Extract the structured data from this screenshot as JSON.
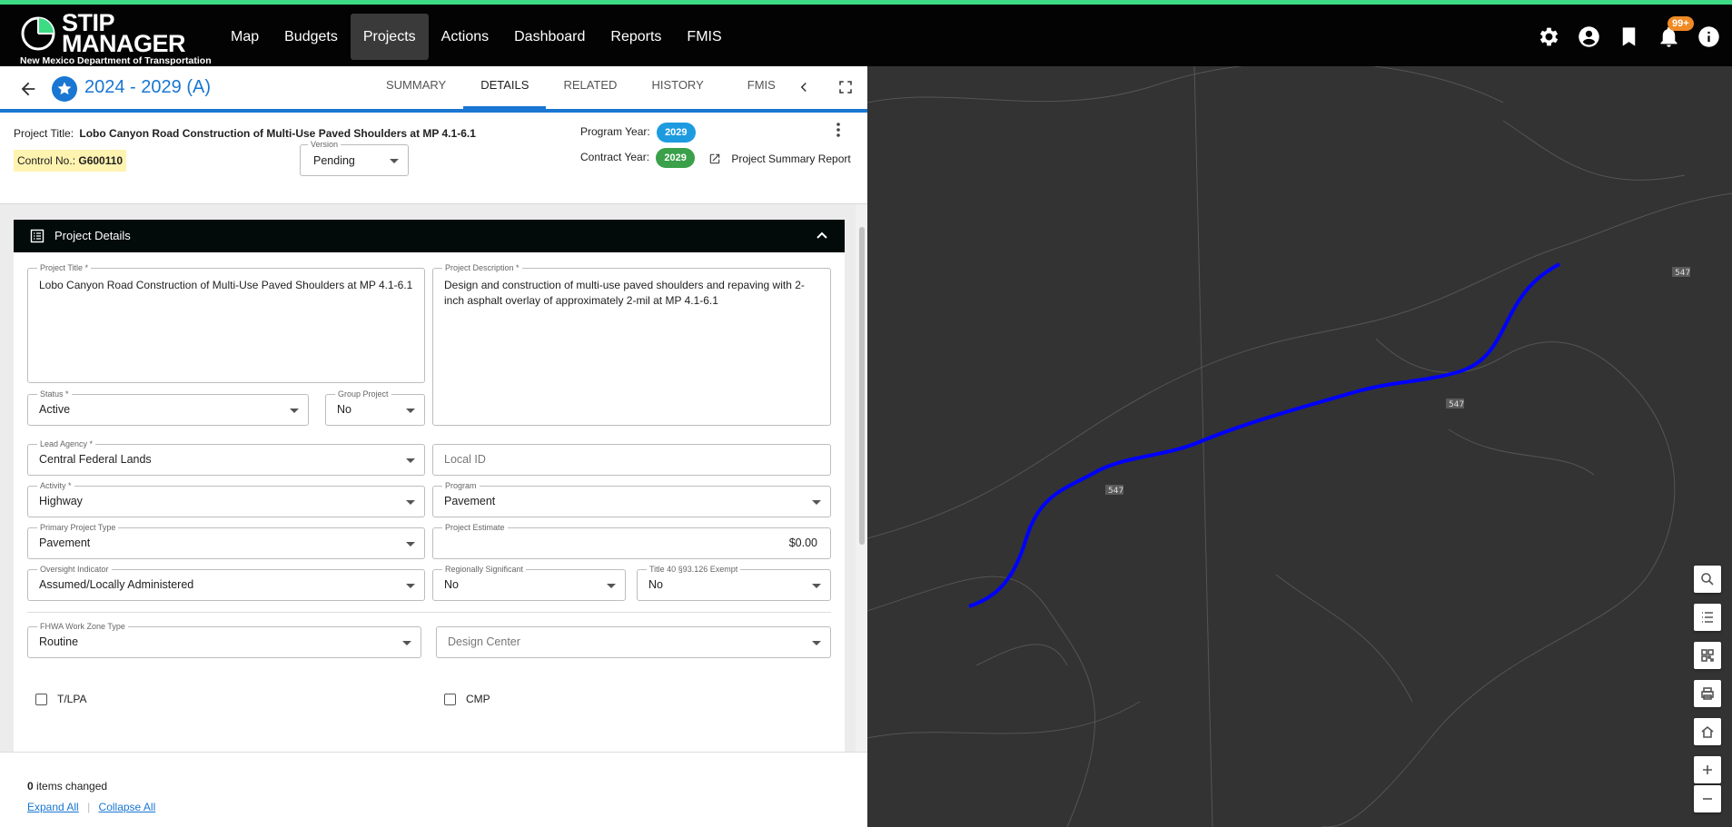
{
  "app": {
    "logo_title_1": "STIP",
    "logo_title_2": "MANAGER",
    "logo_subtitle": "New Mexico Department of Transportation",
    "nav": [
      "Map",
      "Budgets",
      "Projects",
      "Actions",
      "Dashboard",
      "Reports",
      "FMIS"
    ],
    "active_nav": "Projects",
    "notification_count": "99+",
    "accent_color": "#1976d2",
    "top_border_color": "#3ddc84"
  },
  "project_header": {
    "title": "2024 - 2029 (A)",
    "tabs": [
      "SUMMARY",
      "DETAILS",
      "RELATED",
      "HISTORY",
      "FMIS"
    ],
    "active_tab": "DETAILS"
  },
  "summary": {
    "project_title_label": "Project Title:",
    "project_title_value": "Lobo Canyon Road Construction of Multi-Use Paved Shoulders at MP 4.1-6.1",
    "program_year_label": "Program Year:",
    "program_year": "2029",
    "control_no_label": "Control No.:",
    "control_no": "G600110",
    "version_label": "Version",
    "version_value": "Pending",
    "contract_year_label": "Contract Year:",
    "contract_year": "2029",
    "report_link": "Project Summary Report"
  },
  "details": {
    "section_title": "Project Details",
    "project_title_label": "Project Title *",
    "project_title": "Lobo Canyon Road Construction of Multi-Use Paved Shoulders at MP 4.1-6.1",
    "project_description_label": "Project Description *",
    "project_description": "Design and construction of multi-use paved shoulders and repaving with 2-inch asphalt overlay of approximately 2-mil at MP 4.1-6.1",
    "status_label": "Status *",
    "status": "Active",
    "group_project_label": "Group Project",
    "group_project": "No",
    "lead_agency_label": "Lead Agency *",
    "lead_agency": "Central Federal Lands",
    "local_id_placeholder": "Local ID",
    "activity_label": "Activity *",
    "activity": "Highway",
    "program_label": "Program",
    "program": "Pavement",
    "primary_project_type_label": "Primary Project Type",
    "primary_project_type": "Pavement",
    "project_estimate_label": "Project Estimate",
    "project_estimate": "$0.00",
    "oversight_label": "Oversight Indicator",
    "oversight": "Assumed/Locally Administered",
    "regionally_significant_label": "Regionally Significant",
    "regionally_significant": "No",
    "title40_label": "Title 40 §93.126 Exempt",
    "title40": "No",
    "fhwa_label": "FHWA Work Zone Type",
    "fhwa": "Routine",
    "design_center_placeholder": "Design Center",
    "tlpa_label": "T/LPA",
    "cmp_label": "CMP"
  },
  "footer": {
    "items_changed_count": "0",
    "items_changed_text": "items changed",
    "expand_all": "Expand All",
    "collapse_all": "Collapse All"
  },
  "map": {
    "route_labels": [
      "547",
      "547",
      "547"
    ],
    "route_color": "#0000ff",
    "background_color": "#333333"
  }
}
